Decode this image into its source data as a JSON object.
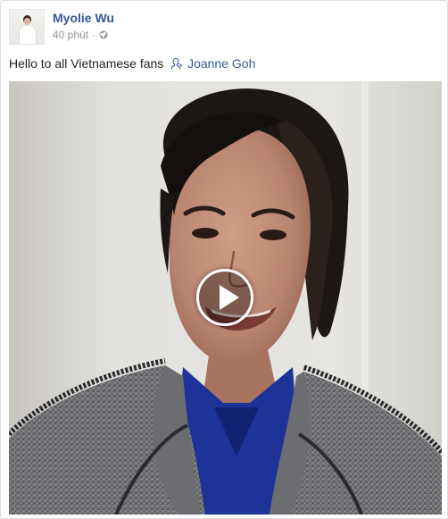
{
  "post": {
    "author": "Myolie Wu",
    "timestamp": "40 phút",
    "separator": "·",
    "privacy_icon": "globe-icon",
    "text": "Hello to all Vietnamese fans",
    "mention_icon": "person-tag-icon",
    "mention": "Joanne Goh",
    "video": {
      "play_icon": "play-icon"
    }
  },
  "colors": {
    "link": "#365899",
    "secondary_text": "#90949c",
    "body_text": "#1d2129"
  }
}
